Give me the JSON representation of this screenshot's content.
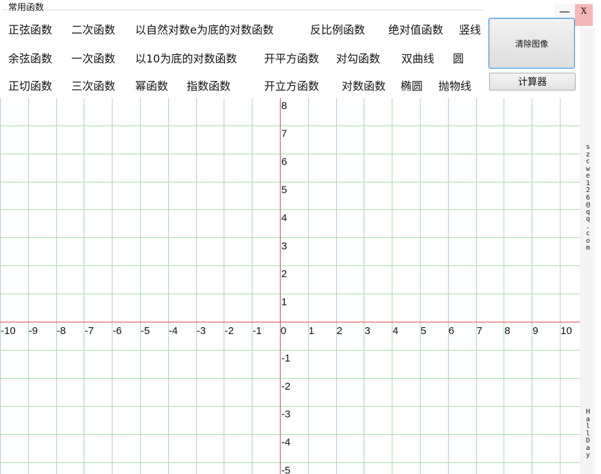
{
  "group": {
    "title": "常用函数"
  },
  "functions": {
    "row1": [
      "正弦函数",
      "二次函数",
      "以自然对数e为底的对数函数",
      "反比例函数",
      "绝对值函数",
      "竖线"
    ],
    "row2": [
      "余弦函数",
      "一次函数",
      "以10为底的对数函数",
      "开平方函数",
      "对勾函数",
      "双曲线",
      "圆"
    ],
    "row3": [
      "正切函数",
      "三次函数",
      "幂函数",
      "指数函数",
      "开立方函数",
      "对数函数",
      "椭圆",
      "抛物线"
    ]
  },
  "buttons": {
    "clear": "清除图像",
    "calculator": "计算器"
  },
  "window": {
    "minimize": "—",
    "close": "X"
  },
  "sidebar": {
    "email": "szcwe126@qq.com",
    "name": "HallDay"
  },
  "graph": {
    "x_ticks": [
      "-10",
      "-9",
      "-8",
      "-7",
      "-6",
      "-5",
      "-4",
      "-3",
      "-2",
      "-1",
      "0",
      "1",
      "2",
      "3",
      "4",
      "5",
      "6",
      "7",
      "8",
      "9",
      "10"
    ],
    "y_ticks": [
      "8",
      "7",
      "6",
      "5",
      "4",
      "3",
      "2",
      "1",
      "-1",
      "-2",
      "-3",
      "-4",
      "-5"
    ],
    "grid_color": "#a6dda6",
    "axis_color": "#d24f4f"
  }
}
